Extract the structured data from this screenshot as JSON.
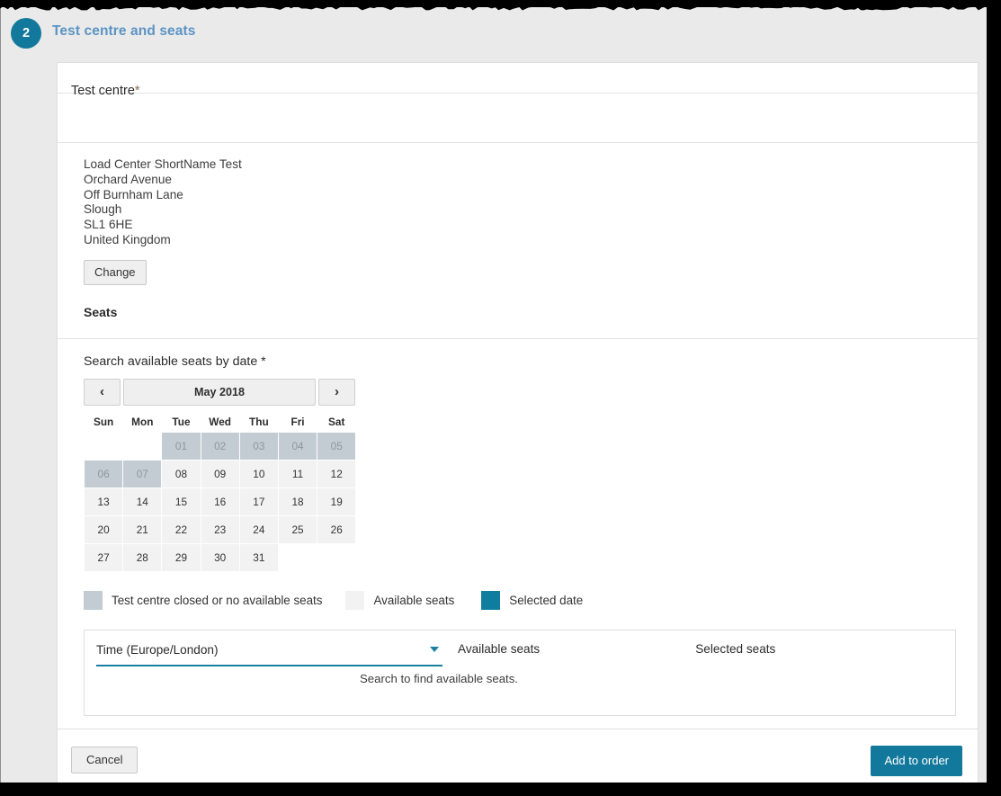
{
  "step": {
    "number": "2",
    "title": "Test centre and seats"
  },
  "test_centre": {
    "section_label": "Test centre",
    "required_marker": "*",
    "address_lines": [
      "Load Center ShortName Test",
      "Orchard Avenue",
      "Off Burnham Lane",
      "Slough",
      "SL1 6HE",
      "United Kingdom"
    ],
    "change_button": "Change"
  },
  "seats": {
    "heading": "Seats",
    "search_label": "Search available seats by date *",
    "calendar": {
      "month_label": "May 2018",
      "prev_icon": "chevron-left-icon",
      "next_icon": "chevron-right-icon",
      "weekdays": [
        "Sun",
        "Mon",
        "Tue",
        "Wed",
        "Thu",
        "Fri",
        "Sat"
      ],
      "weeks": [
        [
          {
            "label": "",
            "state": "empty"
          },
          {
            "label": "",
            "state": "empty"
          },
          {
            "label": "01",
            "state": "closed"
          },
          {
            "label": "02",
            "state": "closed"
          },
          {
            "label": "03",
            "state": "closed"
          },
          {
            "label": "04",
            "state": "closed"
          },
          {
            "label": "05",
            "state": "closed"
          }
        ],
        [
          {
            "label": "06",
            "state": "closed"
          },
          {
            "label": "07",
            "state": "closed"
          },
          {
            "label": "08",
            "state": "available"
          },
          {
            "label": "09",
            "state": "available"
          },
          {
            "label": "10",
            "state": "available"
          },
          {
            "label": "11",
            "state": "available"
          },
          {
            "label": "12",
            "state": "available"
          }
        ],
        [
          {
            "label": "13",
            "state": "available"
          },
          {
            "label": "14",
            "state": "available"
          },
          {
            "label": "15",
            "state": "available"
          },
          {
            "label": "16",
            "state": "available"
          },
          {
            "label": "17",
            "state": "available"
          },
          {
            "label": "18",
            "state": "available"
          },
          {
            "label": "19",
            "state": "available"
          }
        ],
        [
          {
            "label": "20",
            "state": "available"
          },
          {
            "label": "21",
            "state": "available"
          },
          {
            "label": "22",
            "state": "available"
          },
          {
            "label": "23",
            "state": "available"
          },
          {
            "label": "24",
            "state": "available"
          },
          {
            "label": "25",
            "state": "available"
          },
          {
            "label": "26",
            "state": "available"
          }
        ],
        [
          {
            "label": "27",
            "state": "available"
          },
          {
            "label": "28",
            "state": "available"
          },
          {
            "label": "29",
            "state": "available"
          },
          {
            "label": "30",
            "state": "available"
          },
          {
            "label": "31",
            "state": "available"
          },
          {
            "label": "",
            "state": "empty"
          },
          {
            "label": "",
            "state": "empty"
          }
        ]
      ]
    },
    "legend": [
      {
        "label": "Test centre closed or no available seats",
        "color": "#c3ccd3"
      },
      {
        "label": "Available seats",
        "color": "#f2f2f2"
      },
      {
        "label": "Selected date",
        "color": "#0f7d9e"
      }
    ],
    "results": {
      "time_column": "Time (Europe/London)",
      "time_caret_icon": "chevron-down-icon",
      "available_column": "Available seats",
      "selected_column": "Selected seats",
      "empty_message": "Search to find available seats."
    }
  },
  "footer": {
    "cancel_label": "Cancel",
    "add_to_order_label": "Add to order"
  },
  "colors": {
    "accent": "#13799c",
    "step_title": "#5b93c4",
    "closed_day": "#c3ccd3",
    "available_day": "#f2f2f2",
    "page_bg": "#eaeaea"
  }
}
